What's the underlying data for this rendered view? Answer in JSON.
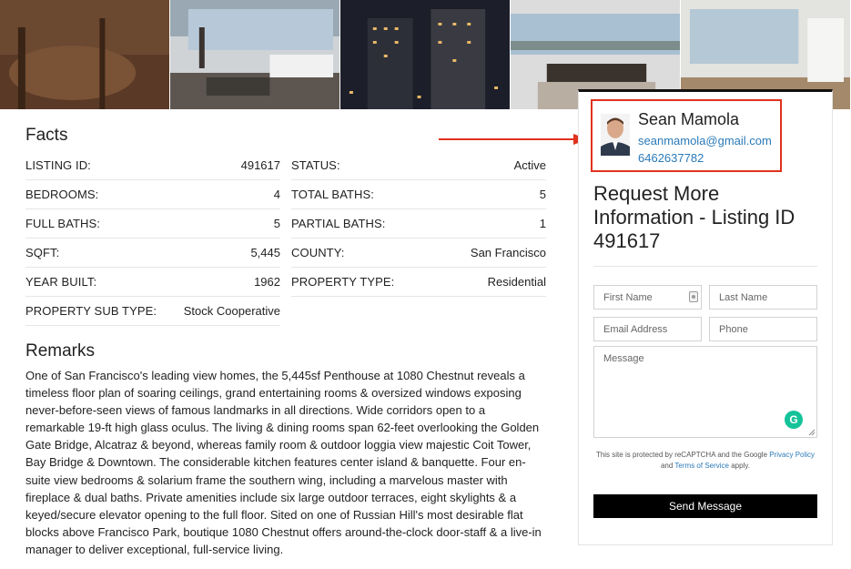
{
  "facts": {
    "title": "Facts",
    "rows": [
      {
        "label": "LISTING ID:",
        "value": "491617"
      },
      {
        "label": "STATUS:",
        "value": "Active"
      },
      {
        "label": "BEDROOMS:",
        "value": "4"
      },
      {
        "label": "TOTAL BATHS:",
        "value": "5"
      },
      {
        "label": "FULL BATHS:",
        "value": "5"
      },
      {
        "label": "PARTIAL BATHS:",
        "value": "1"
      },
      {
        "label": "SQFT:",
        "value": "5,445"
      },
      {
        "label": "COUNTY:",
        "value": "San Francisco"
      },
      {
        "label": "YEAR BUILT:",
        "value": "1962"
      },
      {
        "label": "PROPERTY TYPE:",
        "value": "Residential"
      },
      {
        "label": "PROPERTY SUB TYPE:",
        "value": "Stock Cooperative"
      }
    ]
  },
  "remarks": {
    "title": "Remarks",
    "text": "One of San Francisco's leading view homes, the 5,445sf Penthouse at 1080 Chestnut reveals a timeless floor plan of soaring ceilings, grand entertaining rooms & oversized windows exposing never-before-seen views of famous landmarks in all directions. Wide corridors open to a remarkable 19-ft high glass oculus. The living & dining rooms span 62-feet overlooking the Golden Gate Bridge, Alcatraz & beyond, whereas family room & outdoor loggia view majestic Coit Tower, Bay Bridge & Downtown. The considerable kitchen features center island & banquette. Four en-suite view bedrooms & solarium frame the southern wing, including a marvelous master with fireplace & dual baths. Private amenities include six large outdoor terraces, eight skylights & a keyed/secure elevator opening to the full floor. Sited on one of Russian Hill's most desirable flat blocks above Francisco Park, boutique 1080 Chestnut offers around-the-clock door-staff & a live-in manager to deliver exceptional, full-service living."
  },
  "agent": {
    "name": "Sean Mamola",
    "email": "seanmamola@gmail.com",
    "phone": "6462637782"
  },
  "form": {
    "title": "Request More Information - Listing ID 491617",
    "first_name_placeholder": "First Name",
    "last_name_placeholder": "Last Name",
    "email_placeholder": "Email Address",
    "phone_placeholder": "Phone",
    "message_placeholder": "Message",
    "captcha_prefix": "This site is protected by reCAPTCHA and the Google",
    "privacy_link": "Privacy Policy",
    "captcha_and": "and",
    "terms_link": "Terms of Service",
    "captcha_suffix": "apply.",
    "send_label": "Send Message"
  },
  "colors": {
    "highlight_border": "#e0321e",
    "link": "#2a7ab8",
    "button_bg": "#000000"
  }
}
